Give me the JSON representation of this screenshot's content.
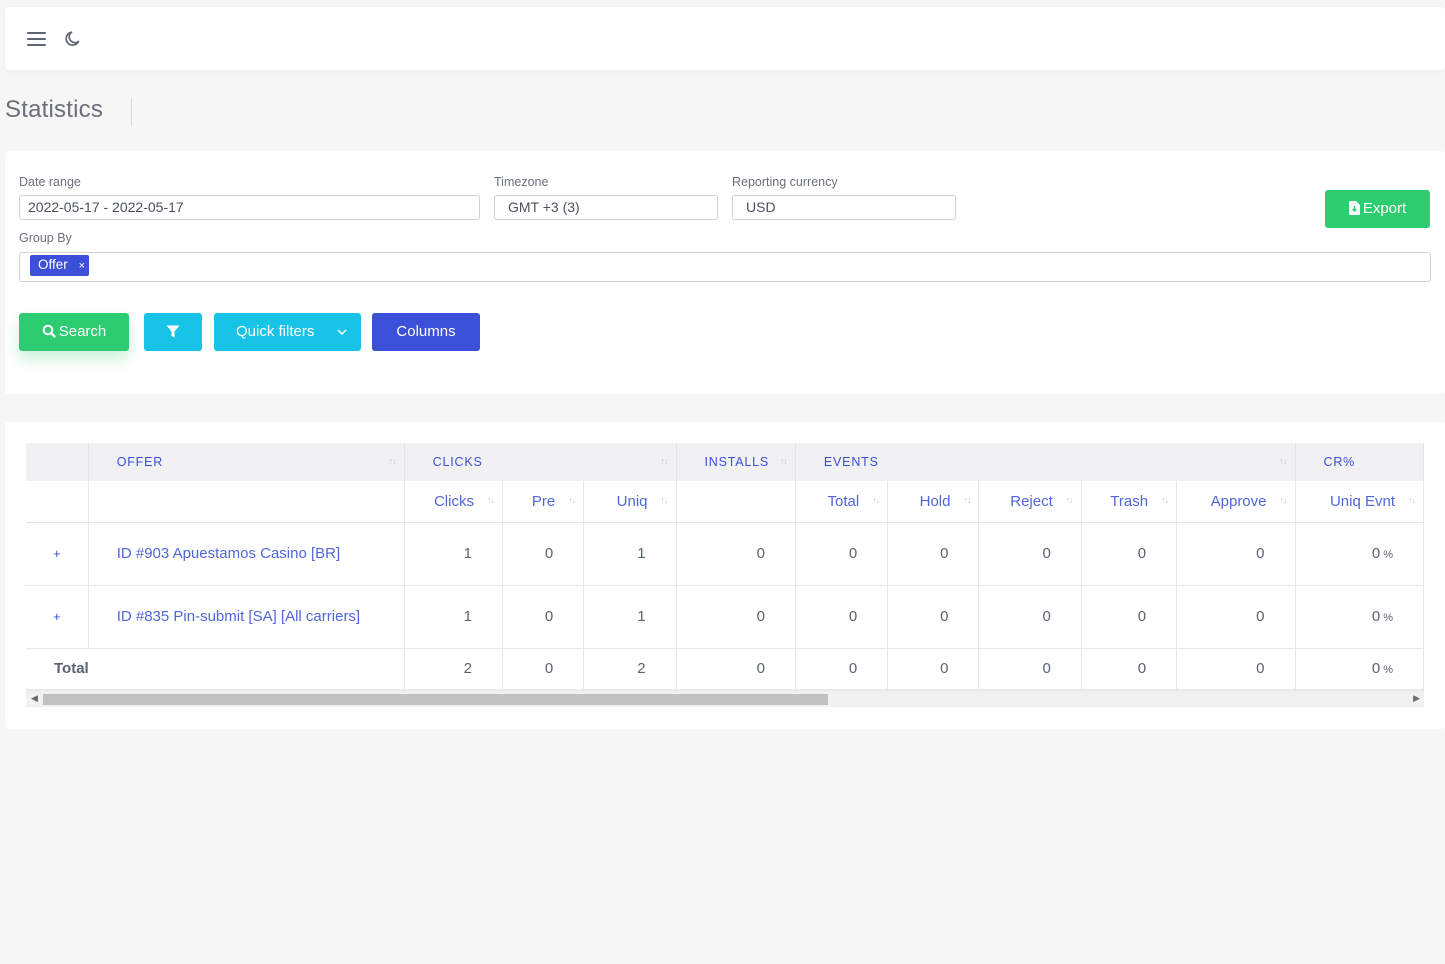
{
  "header": {
    "menu_icon": "hamburger-menu-icon",
    "theme_icon": "moon-icon"
  },
  "page": {
    "title": "Statistics"
  },
  "filters": {
    "date_range_label": "Date range",
    "date_range_value": "2022-05-17 - 2022-05-17",
    "timezone_label": "Timezone",
    "timezone_value": "GMT +3 (3)",
    "currency_label": "Reporting currency",
    "currency_value": "USD",
    "group_by_label": "Group By",
    "group_by_tags": [
      "Offer"
    ],
    "export_label": "Export",
    "search_label": "Search",
    "quick_filters_label": "Quick filters",
    "columns_label": "Columns"
  },
  "colors": {
    "green": "#2ecc71",
    "cyan": "#17c3e6",
    "blue": "#3b4fd8"
  },
  "table": {
    "group_headers": [
      "OFFER",
      "CLICKS",
      "INSTALLS",
      "EVENTS",
      "CR%"
    ],
    "sub_headers": [
      "Clicks",
      "Pre",
      "Uniq",
      "Total",
      "Hold",
      "Reject",
      "Trash",
      "Approve",
      "Uniq Evnt"
    ],
    "rows": [
      {
        "expand": "+",
        "offer": "ID #903 Apuestamos Casino [BR]",
        "clicks": "1",
        "pre": "0",
        "uniq": "1",
        "installs": "0",
        "total": "0",
        "hold": "0",
        "reject": "0",
        "trash": "0",
        "approve": "0",
        "cr": "0",
        "cr_unit": "%"
      },
      {
        "expand": "+",
        "offer": "ID #835 Pin-submit [SA] [All carriers]",
        "clicks": "1",
        "pre": "0",
        "uniq": "1",
        "installs": "0",
        "total": "0",
        "hold": "0",
        "reject": "0",
        "trash": "0",
        "approve": "0",
        "cr": "0",
        "cr_unit": "%"
      }
    ],
    "totals": {
      "label": "Total",
      "clicks": "2",
      "pre": "0",
      "uniq": "2",
      "installs": "0",
      "total": "0",
      "hold": "0",
      "reject": "0",
      "trash": "0",
      "approve": "0",
      "cr": "0",
      "cr_unit": "%"
    }
  }
}
